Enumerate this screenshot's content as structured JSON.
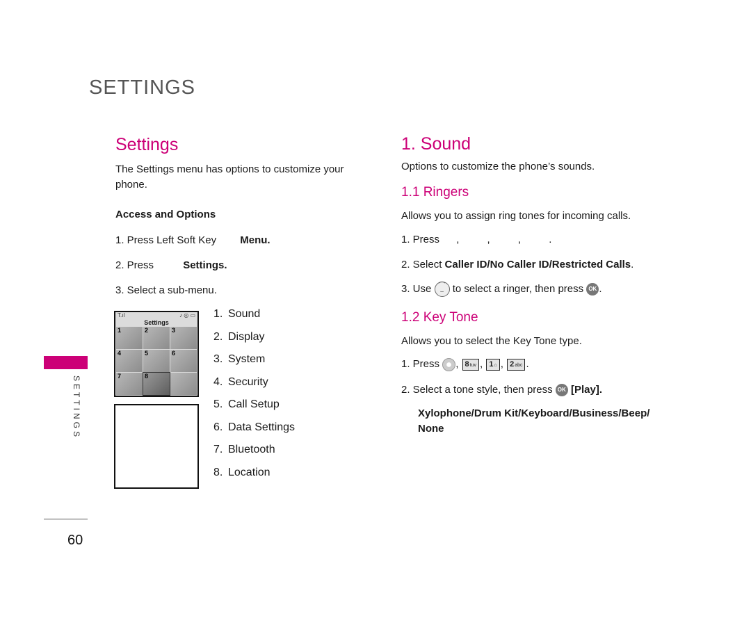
{
  "chapter_header": "SETTINGS",
  "side_label": "SETTINGS",
  "page_number": "60",
  "colors": {
    "accent": "#cc0077",
    "text": "#1a1a1a",
    "chapter": "#555555"
  },
  "left": {
    "title": "Settings",
    "intro": "The Settings menu has options to customize your phone.",
    "access_heading": "Access and Options",
    "steps": [
      {
        "text": "1. Press Left Soft Key",
        "bold": "Menu."
      },
      {
        "text": "2. Press",
        "bold": "Settings."
      },
      {
        "text": "3. Select a sub-menu.",
        "bold": ""
      }
    ],
    "screen": {
      "title": "Settings",
      "signal_icon": "signal-icon",
      "status_icons": [
        "music-note-icon",
        "location-icon",
        "battery-icon"
      ],
      "cells": [
        "1",
        "2",
        "3",
        "4",
        "5",
        "6",
        "7",
        "8",
        ""
      ]
    },
    "menu_items": [
      {
        "num": "1.",
        "label": "Sound"
      },
      {
        "num": "2.",
        "label": "Display"
      },
      {
        "num": "3.",
        "label": "System"
      },
      {
        "num": "4.",
        "label": "Security"
      },
      {
        "num": "5.",
        "label": "Call Setup"
      },
      {
        "num": "6.",
        "label": "Data Settings"
      },
      {
        "num": "7.",
        "label": "Bluetooth"
      },
      {
        "num": "8.",
        "label": "Location"
      }
    ]
  },
  "right": {
    "title": "1. Sound",
    "intro": "Options to customize the phone’s sounds.",
    "ringers": {
      "title": "1.1 Ringers",
      "desc": "Allows you to assign ring tones for incoming calls.",
      "step1": "1. Press",
      "step1_seps": [
        ",",
        ",",
        ",",
        "."
      ],
      "step2_prefix": "2. Select ",
      "step2_bold": "Caller ID/No Caller ID/Restricted Calls",
      "step2_suffix": ".",
      "step3_prefix": "3. Use",
      "step3_middle": "to select a ringer, then press",
      "step3_suffix": ".",
      "ok_label": "OK"
    },
    "key_tone": {
      "title": "1.2 Key Tone",
      "desc": "Allows you to select the Key Tone type.",
      "step1": "1. Press",
      "keys": [
        {
          "digit": "8",
          "letters": "tuv"
        },
        {
          "digit": "1",
          "letters": "⌂"
        },
        {
          "digit": "2",
          "letters": "abc"
        }
      ],
      "step2_prefix": "2. Select a tone style, then press",
      "step2_bold": "[Play].",
      "ok_label": "OK",
      "options": "Xylophone/Drum Kit/Keyboard/Business/Beep/ None"
    }
  }
}
